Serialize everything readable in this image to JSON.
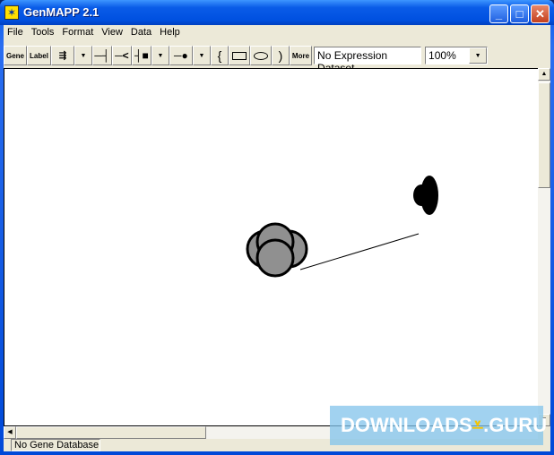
{
  "window": {
    "title": "GenMAPP 2.1",
    "minimize": "_",
    "maximize": "□",
    "close": "✕"
  },
  "menu": [
    "File",
    "Tools",
    "Format",
    "View",
    "Data",
    "Help"
  ],
  "toolbar": {
    "gene": "Gene",
    "label": "Label",
    "more": "More",
    "expression_dataset": "No Expression Dataset",
    "zoom": "100%"
  },
  "status": {
    "database": "No Gene Database"
  },
  "watermark": {
    "text1": "DOWNLOADS",
    "text2": ".GURU"
  }
}
